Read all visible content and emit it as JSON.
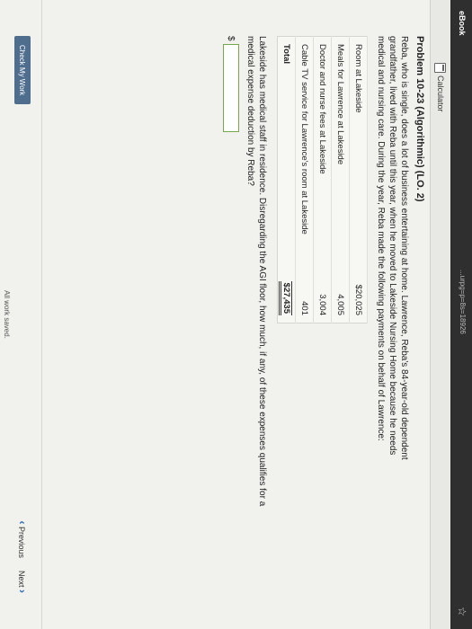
{
  "topbar": {
    "brand": "eBook",
    "url_fragment": "...urpg=p=8s=18926"
  },
  "toolbar": {
    "calculator": "Calculator"
  },
  "problem": {
    "title": "Problem 10-23 (Algorithmic) (LO. 2)",
    "intro": "Reba, who is single, does a lot of business entertaining at home. Lawrence, Reba's 84-year-old dependent grandfather, lived with Reba until this year, when he moved to Lakeside Nursing Home because he needs medical and nursing care. During the year, Reba made the following payments on behalf of Lawrence:",
    "payments": [
      {
        "label": "Room at Lakeside",
        "amount": "$20,025"
      },
      {
        "label": "Meals for Lawrence at Lakeside",
        "amount": "4,005"
      },
      {
        "label": "Doctor and nurse fees at Lakeside",
        "amount": "3,004"
      },
      {
        "label": "Cable TV service for Lawrence's room at Lakeside",
        "amount": "401"
      }
    ],
    "total": {
      "label": "Total",
      "amount": "$27,435"
    },
    "question": "Lakeside has medical staff in residence. Disregarding the AGI floor, how much, if any, of these expenses qualifies for a medical expense deduction by Reba?",
    "answer": {
      "prefix": "$",
      "value": "",
      "placeholder": ""
    }
  },
  "footer": {
    "check_label": "Check My Work",
    "previous_label": "Previous",
    "next_label": "Next",
    "saved_status": "All work saved."
  },
  "colors": {
    "accent": "#2d6fb8",
    "check_button": "#4f6e8e",
    "input_border": "#7aa64b"
  }
}
